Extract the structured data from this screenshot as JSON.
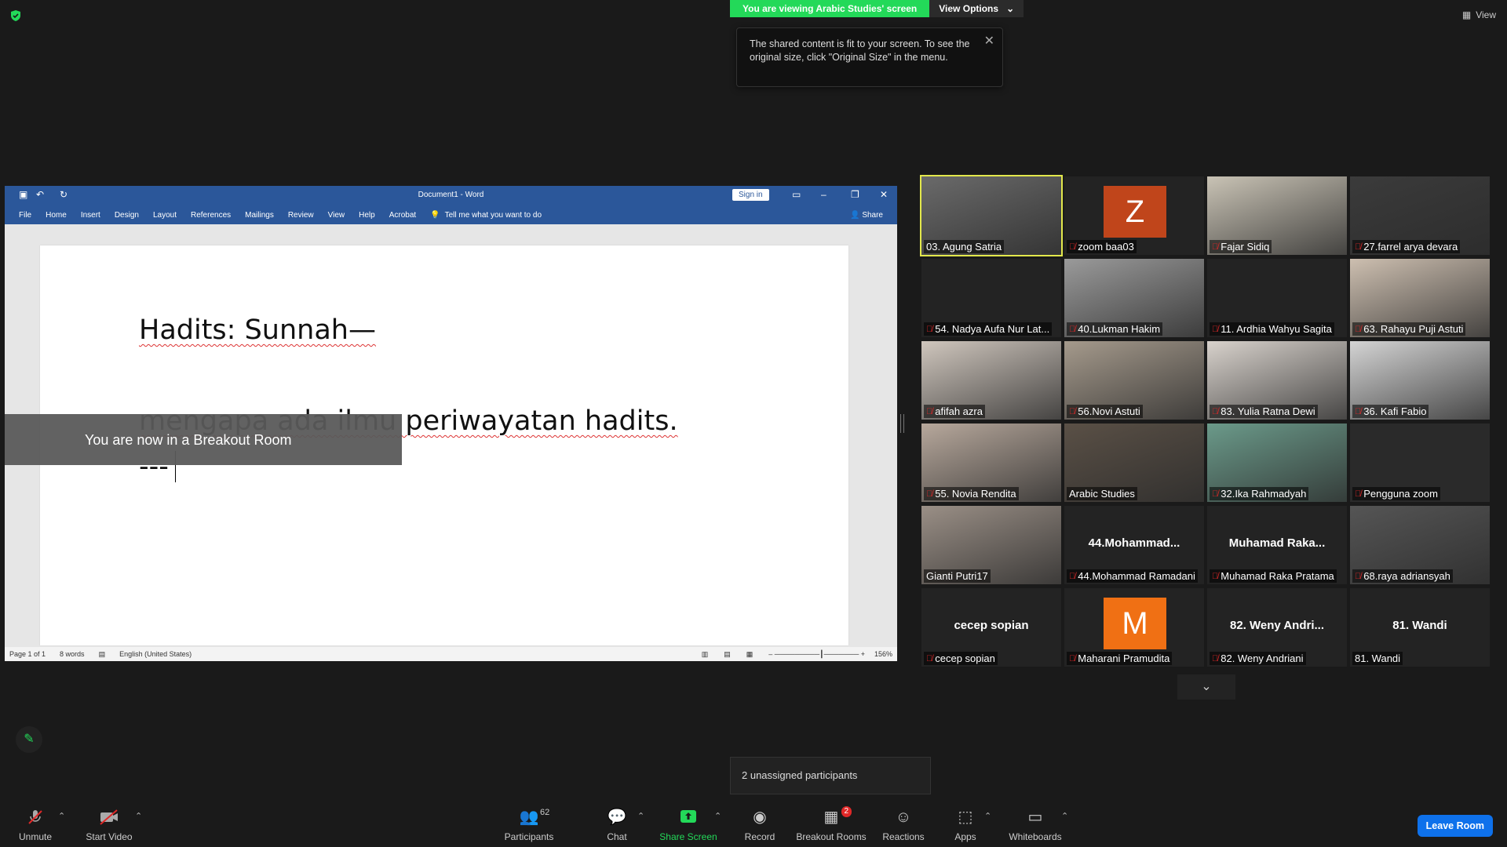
{
  "banner": {
    "viewing": "You are viewing Arabic Studies' screen",
    "view_options": "View Options",
    "view_options_caret": "⌄"
  },
  "tooltip": {
    "text": "The shared content is fit to your screen. To see the original size, click \"Original Size\" in the menu.",
    "close": "✕"
  },
  "view_top": {
    "label": "View"
  },
  "word": {
    "title": "Document1 - Word",
    "sign_in": "Sign in",
    "share": "Share",
    "tell_me": "Tell me what you want to do",
    "ribbon": [
      "File",
      "Home",
      "Insert",
      "Design",
      "Layout",
      "References",
      "Mailings",
      "Review",
      "View",
      "Help",
      "Acrobat"
    ],
    "lines": [
      "Hadits: Sunnah—",
      "mengapa ada ilmu periwayatan hadits.",
      "---"
    ],
    "status": {
      "page": "Page 1 of 1",
      "words": "8 words",
      "lang": "English (United States)",
      "zoom": "156%"
    }
  },
  "breakout_toast": "You are now in a Breakout Room",
  "participants": [
    {
      "label": "03. Agung Satria",
      "muted": false,
      "type": "video",
      "color": "#6a6a6a",
      "active": true
    },
    {
      "label": "zoom baa03",
      "muted": true,
      "type": "letter",
      "letter": "Z",
      "color": "#c0451b"
    },
    {
      "label": "Fajar Sidiq",
      "muted": true,
      "type": "video",
      "color": "#c9c3b5"
    },
    {
      "label": "27.farrel arya devara",
      "muted": true,
      "type": "video",
      "color": "#3b3b3b"
    },
    {
      "label": "54. Nadya Aufa Nur Lat...",
      "muted": true,
      "type": "blank",
      "color": "#232323"
    },
    {
      "label": "40.Lukman Hakim",
      "muted": true,
      "type": "video",
      "color": "#9a9a9a"
    },
    {
      "label": "11. Ardhia Wahyu Sagita",
      "muted": true,
      "type": "blank",
      "color": "#232323"
    },
    {
      "label": "63. Rahayu Puji Astuti",
      "muted": true,
      "type": "video",
      "color": "#cdbfb0"
    },
    {
      "label": "afifah azra",
      "muted": true,
      "type": "video",
      "color": "#cfc6bd"
    },
    {
      "label": "56.Novi Astuti",
      "muted": true,
      "type": "video",
      "color": "#a59a8c"
    },
    {
      "label": "83. Yulia Ratna Dewi",
      "muted": true,
      "type": "video",
      "color": "#d8d2cc"
    },
    {
      "label": "36. Kafi Fabio",
      "muted": true,
      "type": "video",
      "color": "#d4d4d4"
    },
    {
      "label": "55. Novia Rendita",
      "muted": true,
      "type": "video",
      "color": "#b7a89c"
    },
    {
      "label": "Arabic Studies",
      "muted": false,
      "type": "video",
      "color": "#5a5046"
    },
    {
      "label": "32.Ika Rahmadyah",
      "muted": true,
      "type": "video",
      "color": "#6b9a8a"
    },
    {
      "label": "Pengguna zoom",
      "muted": true,
      "type": "video",
      "color": "#2a2a2a"
    },
    {
      "label": "Gianti Putri17",
      "muted": false,
      "type": "video",
      "color": "#9a8f86"
    },
    {
      "label": "44.Mohammad Ramadani",
      "muted": true,
      "type": "name",
      "center": "44.Mohammad...",
      "color": "#232323"
    },
    {
      "label": "Muhamad Raka Pratama",
      "muted": true,
      "type": "name",
      "center": "Muhamad  Raka...",
      "color": "#232323"
    },
    {
      "label": "68.raya adriansyah",
      "muted": true,
      "type": "video",
      "color": "#555"
    },
    {
      "label": "cecep sopian",
      "muted": true,
      "type": "name",
      "center": "cecep sopian",
      "color": "#232323"
    },
    {
      "label": "Maharani Pramudita",
      "muted": true,
      "type": "letter",
      "letter": "M",
      "color": "#f07014"
    },
    {
      "label": "82. Weny Andriani",
      "muted": true,
      "type": "name",
      "center": "82. Weny Andri...",
      "color": "#232323"
    },
    {
      "label": "81. Wandi",
      "muted": false,
      "type": "name",
      "center": "81. Wandi",
      "color": "#232323"
    }
  ],
  "unassigned": "2 unassigned participants",
  "toolbar": {
    "unmute": "Unmute",
    "start_video": "Start Video",
    "participants": "Participants",
    "participants_count": "62",
    "chat": "Chat",
    "share_screen": "Share Screen",
    "record": "Record",
    "breakout_rooms": "Breakout Rooms",
    "breakout_badge": "2",
    "reactions": "Reactions",
    "apps": "Apps",
    "whiteboards": "Whiteboards",
    "leave_room": "Leave Room"
  }
}
